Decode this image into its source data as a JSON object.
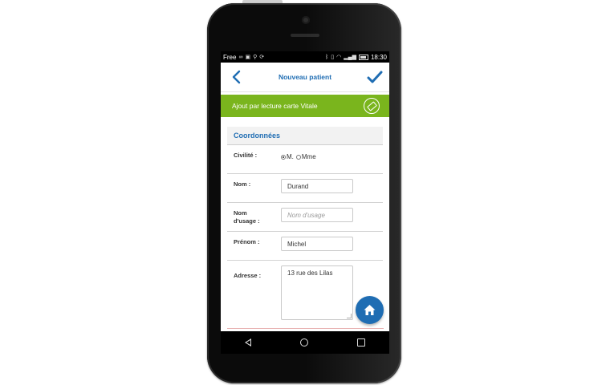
{
  "statusbar": {
    "carrier": "Free",
    "time": "18:30"
  },
  "appbar": {
    "title": "Nouveau patient"
  },
  "vitale_bar": {
    "label": "Ajout par lecture carte Vitale"
  },
  "section": {
    "title": "Coordonnées"
  },
  "form": {
    "civilite": {
      "label": "Civilité :",
      "options": [
        "M.",
        "Mme"
      ],
      "selected": "M."
    },
    "nom": {
      "label": "Nom :",
      "value": "Durand"
    },
    "nom_usage": {
      "label_line1": "Nom",
      "label_line2": "d'usage :",
      "placeholder": "Nom d'usage",
      "value": ""
    },
    "prenom": {
      "label": "Prénom :",
      "value": "Michel"
    },
    "adresse": {
      "label": "Adresse :",
      "value": "13 rue des Lilas"
    }
  },
  "colors": {
    "primary": "#1f6db3",
    "vitale_green": "#7ab51d",
    "status_black": "#000000"
  },
  "icons": {
    "back": "chevron-left-icon",
    "confirm": "checkmark-icon",
    "vitale": "vitale-card-icon",
    "home_fab": "home-icon"
  }
}
